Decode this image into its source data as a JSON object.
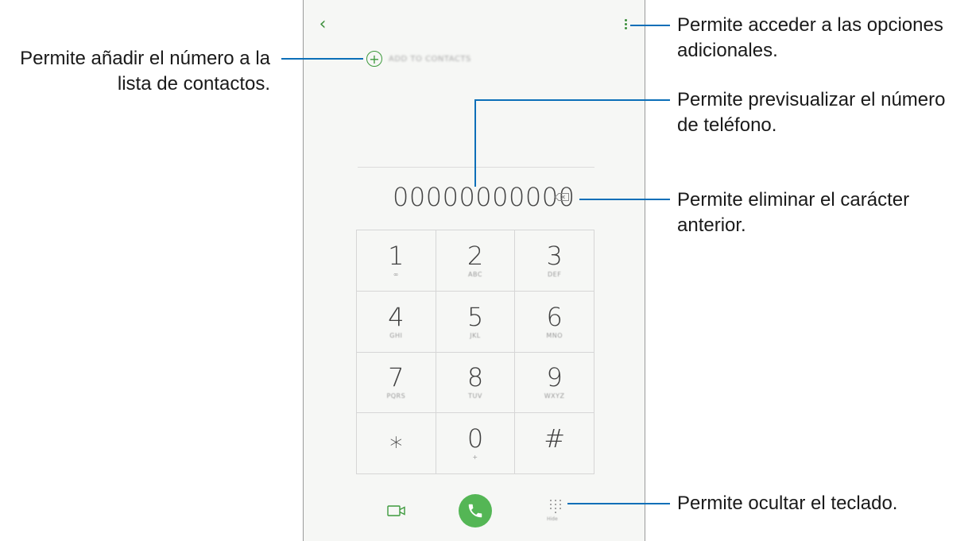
{
  "phone": {
    "add_to_contacts_label": "ADD TO CONTACTS",
    "phone_number": "00000000000",
    "keypad": [
      {
        "digit": "1",
        "letters": "∞"
      },
      {
        "digit": "2",
        "letters": "ABC"
      },
      {
        "digit": "3",
        "letters": "DEF"
      },
      {
        "digit": "4",
        "letters": "GHI"
      },
      {
        "digit": "5",
        "letters": "JKL"
      },
      {
        "digit": "6",
        "letters": "MNO"
      },
      {
        "digit": "7",
        "letters": "PQRS"
      },
      {
        "digit": "8",
        "letters": "TUV"
      },
      {
        "digit": "9",
        "letters": "WXYZ"
      },
      {
        "digit": "⁎",
        "letters": ""
      },
      {
        "digit": "0",
        "letters": "+"
      },
      {
        "digit": "#",
        "letters": ""
      }
    ],
    "hide_label": "Hide",
    "icons": {
      "back": "chevron-left-icon",
      "more": "more-options-icon",
      "add": "add-contact-icon",
      "backspace": "backspace-icon",
      "video": "video-call-icon",
      "call": "phone-call-icon",
      "dialpad": "dialpad-icon"
    },
    "colors": {
      "accent_green": "#3d9a3d",
      "call_button": "#54b655",
      "callout_line": "#0b6fb8"
    }
  },
  "callouts": {
    "options": "Permite acceder a las opciones adicionales.",
    "add_contact": "Permite añadir el número a la lista de contactos.",
    "preview": "Permite previsualizar el número de teléfono.",
    "delete": "Permite eliminar el carácter anterior.",
    "hide_keypad": "Permite ocultar el teclado."
  }
}
